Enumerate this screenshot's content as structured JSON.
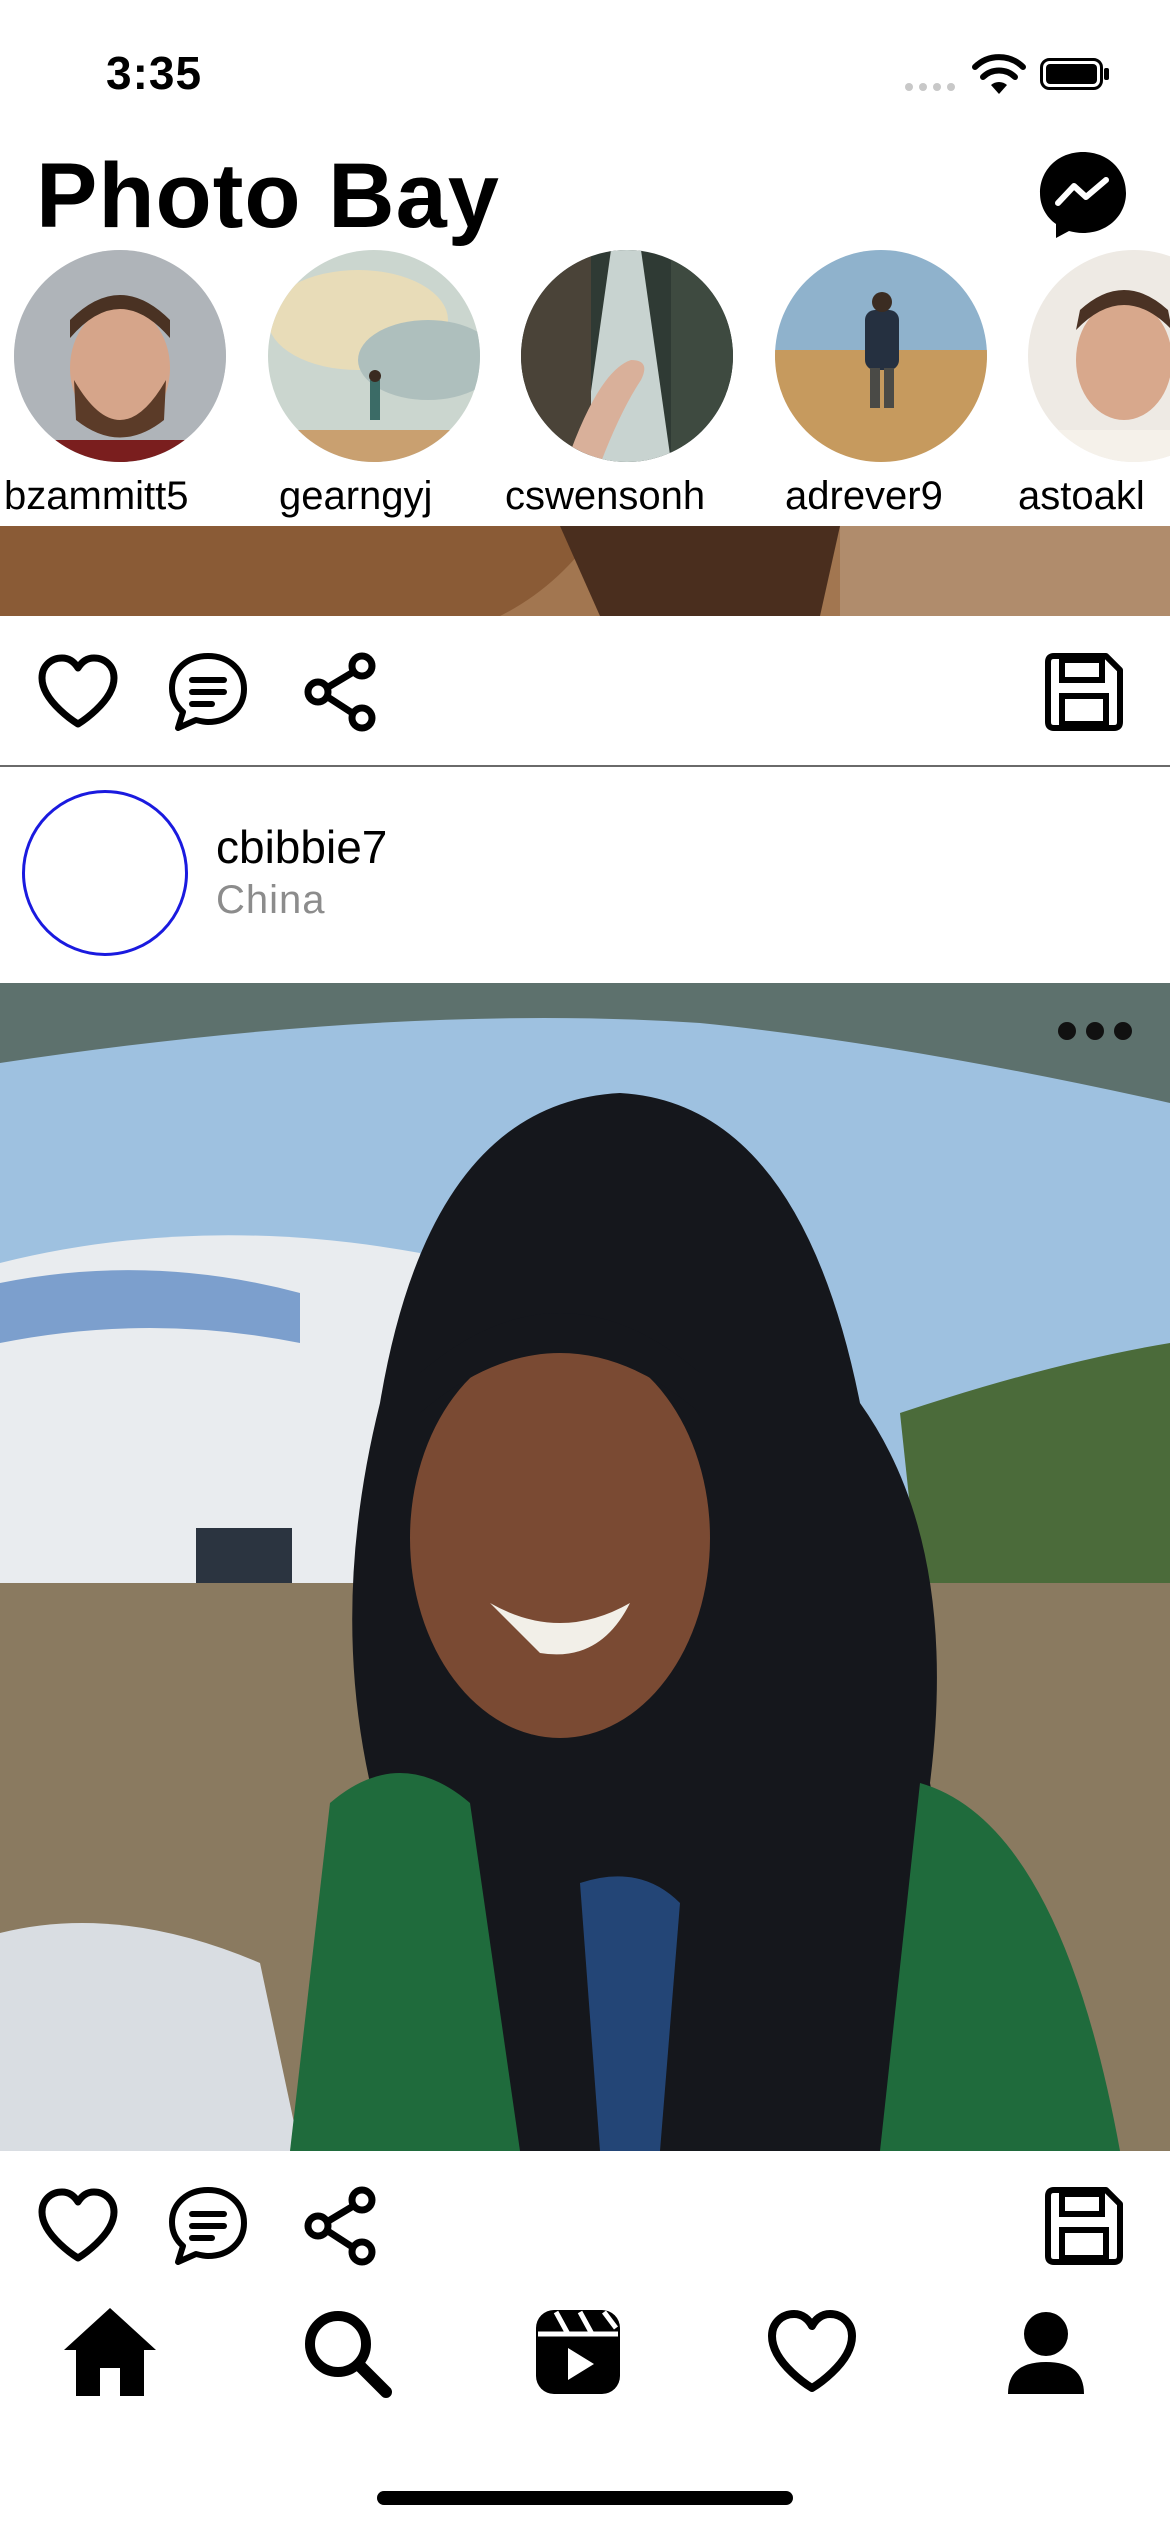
{
  "status_bar": {
    "time": "3:35"
  },
  "header": {
    "title": "Photo Bay",
    "messenger_icon": "messenger-icon"
  },
  "stories": [
    {
      "username": "bzammitt5"
    },
    {
      "username": "gearngyj"
    },
    {
      "username": "cswensonh"
    },
    {
      "username": "adrever9"
    },
    {
      "username": "astoakl"
    }
  ],
  "post": {
    "username": "cbibbie7",
    "location": "China"
  },
  "actions": {
    "like_icon": "heart-icon",
    "comment_icon": "comment-icon",
    "share_icon": "share-icon",
    "save_icon": "save-icon"
  },
  "tab_bar": [
    "home-icon",
    "search-icon",
    "reels-icon",
    "heart-icon",
    "profile-icon"
  ],
  "colors": {
    "avatar_ring": "#1a1adf",
    "text": "#000000",
    "location": "#8c8c8c"
  }
}
